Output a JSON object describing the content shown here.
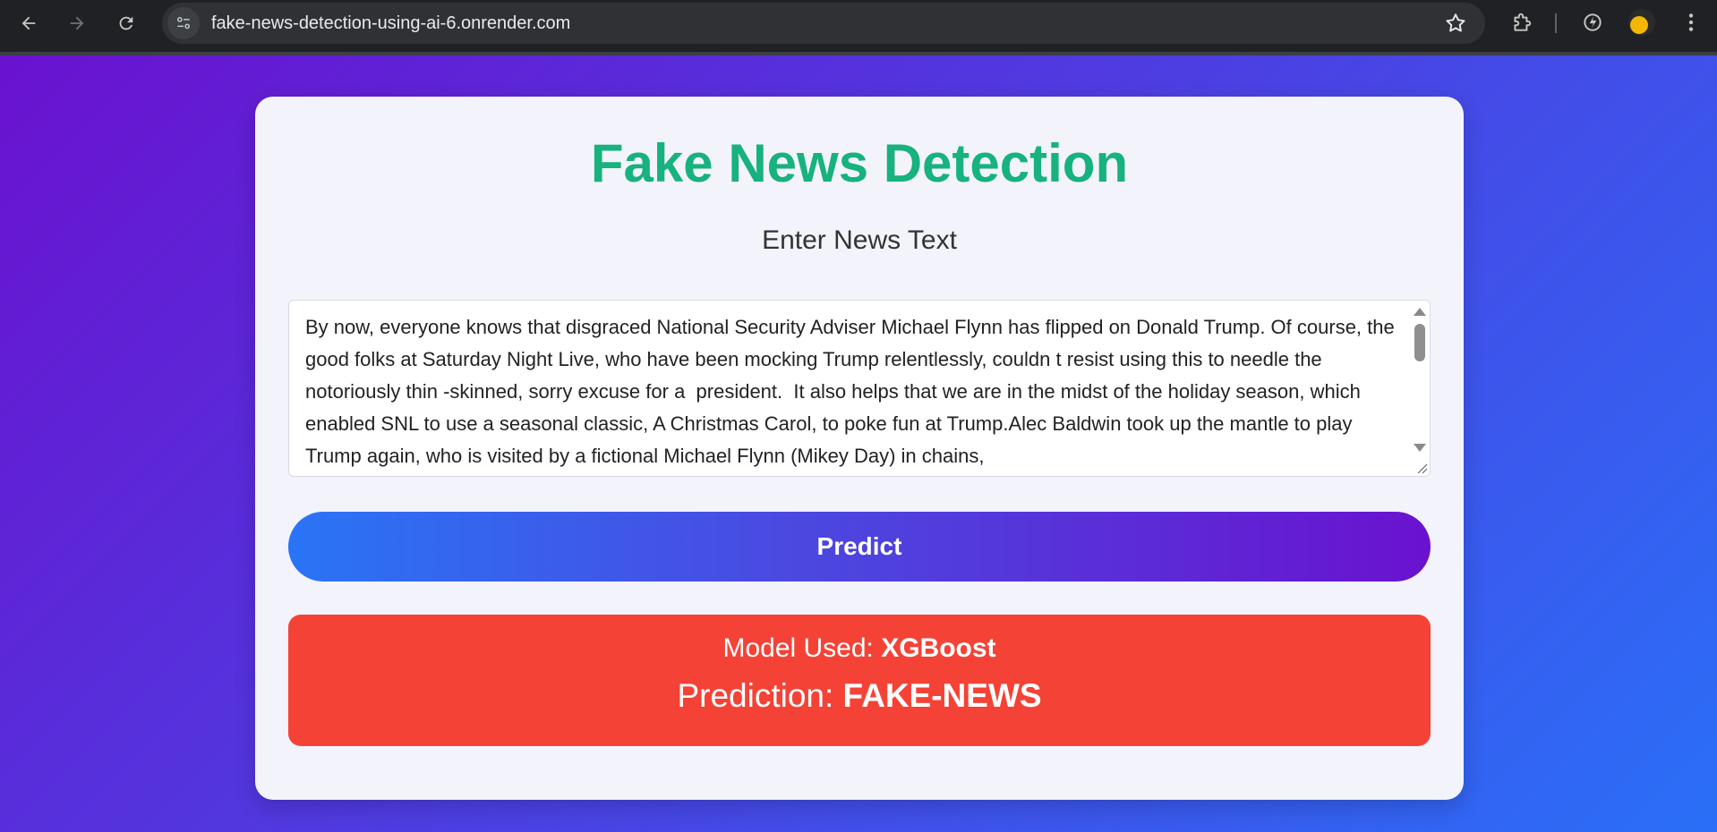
{
  "browser": {
    "url": "fake-news-detection-using-ai-6.onrender.com",
    "icons": {
      "back": "back-arrow-icon",
      "forward": "forward-arrow-icon",
      "reload": "reload-icon",
      "site_info": "site-info-icon",
      "bookmark": "star-icon",
      "extensions": "puzzle-icon",
      "performance": "speed-icon",
      "menu": "kebab-menu-icon"
    }
  },
  "app": {
    "title": "Fake News Detection",
    "subtitle": "Enter News Text",
    "news_text": "By now, everyone knows that disgraced National Security Adviser Michael Flynn has flipped on Donald Trump. Of course, the good folks at Saturday Night Live, who have been mocking Trump relentlessly, couldn t resist using this to needle the notoriously thin -skinned, sorry excuse for a  president.  It also helps that we are in the midst of the holiday season, which enabled SNL to use a seasonal classic, A Christmas Carol, to poke fun at Trump.Alec Baldwin took up the mantle to play Trump again, who is visited by a fictional Michael Flynn (Mikey Day) in chains,",
    "predict_label": "Predict",
    "result": {
      "model_label": "Model Used: ",
      "model_value": "XGBoost",
      "prediction_label": "Prediction: ",
      "prediction_value": "FAKE-NEWS"
    }
  },
  "colors": {
    "title": "#17b27d",
    "result_bg": "#f44336",
    "gradient_start": "#6a12cf",
    "gradient_end": "#2a6ff7"
  }
}
